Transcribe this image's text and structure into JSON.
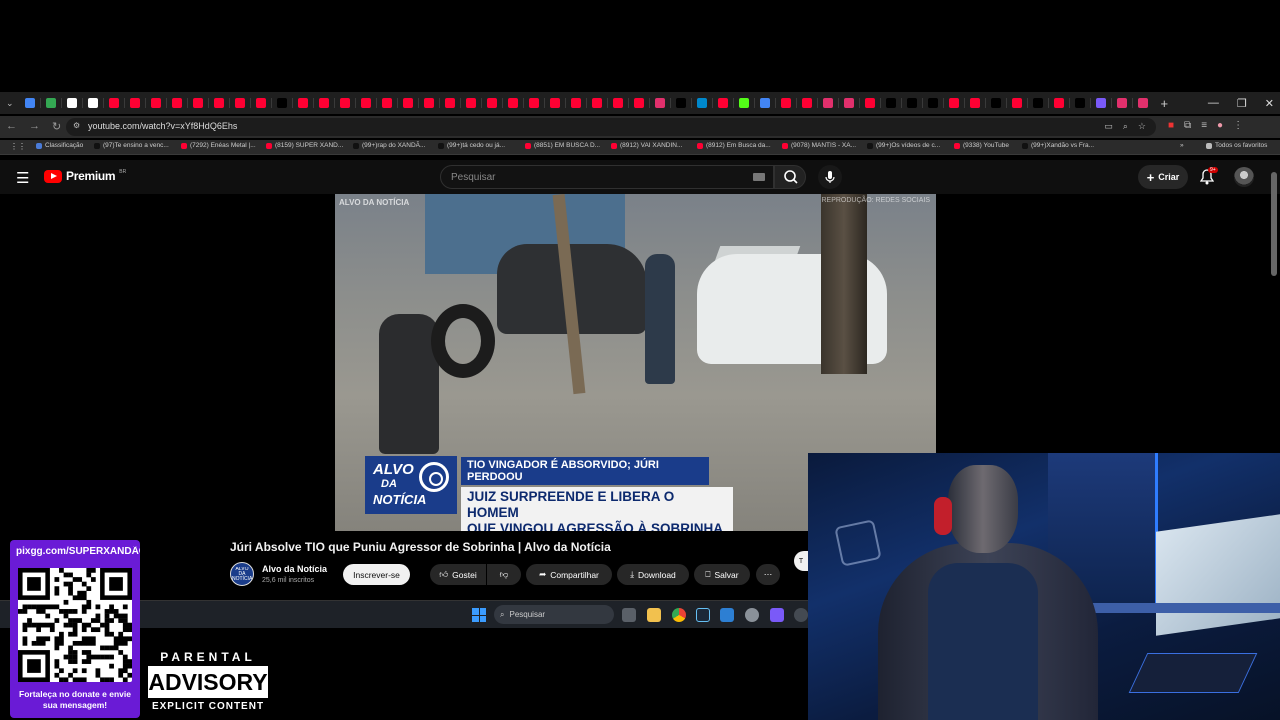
{
  "browser": {
    "tab_colors": [
      "#4285f4",
      "#34a853",
      "#fff",
      "#ffffff",
      "#ff0033",
      "#ff0033",
      "#ff0033",
      "#ff0033",
      "#ff0033",
      "#ff0033",
      "#ff0033",
      "#ff0033",
      "#000",
      "#ff0033",
      "#ff0033",
      "#ff0033",
      "#ff0033",
      "#ff0033",
      "#ff0033",
      "#ff0033",
      "#ff0033",
      "#ff0033",
      "#ff0033",
      "#ff0033",
      "#ff0033",
      "#ff0033",
      "#ff0033",
      "#ff0033",
      "#ff0033",
      "#ff0033",
      "#e1306c",
      "#000",
      "#0088cc",
      "#ff0033",
      "#53fc18",
      "#4285f4",
      "#ff0033",
      "#ff0033",
      "#e1306c",
      "#e1306c",
      "#ff0033",
      "#000",
      "#000",
      "#000",
      "#ff0033",
      "#ff0033",
      "#000",
      "#ff0033",
      "#000",
      "#ff0033",
      "#000",
      "#7a5af8",
      "#e1306c",
      "#e1306c"
    ],
    "url": "youtube.com/watch?v=xYf8HdQ6Ehs",
    "bookmarks": [
      {
        "label": "Classificação",
        "color": "#4a7bd8"
      },
      {
        "label": "(97)Te ensino a venc...",
        "color": "#111"
      },
      {
        "label": "(7292) Enéas Metal |...",
        "color": "#ff0033"
      },
      {
        "label": "(8159) SUPER XAND...",
        "color": "#ff0033"
      },
      {
        "label": "(99+)rap do XANDÃ...",
        "color": "#111"
      },
      {
        "label": "(99+)tá cedo ou já...",
        "color": "#111"
      },
      {
        "label": "(8851) EM BUSCA D...",
        "color": "#ff0033"
      },
      {
        "label": "(8912) VAI XANDIN...",
        "color": "#ff0033"
      },
      {
        "label": "(8912) Em Busca da...",
        "color": "#ff0033"
      },
      {
        "label": "(9078) MANTIS - XA...",
        "color": "#ff0033"
      },
      {
        "label": "(99+)Os vídeos de c...",
        "color": "#111"
      },
      {
        "label": "(9338) YouTube",
        "color": "#ff0033"
      },
      {
        "label": "(99+)Xandão vs Fra...",
        "color": "#111"
      }
    ],
    "all_favorites": "Todos os favoritos"
  },
  "youtube": {
    "brand": "Premium",
    "region": "BR",
    "search_placeholder": "Pesquisar",
    "create_label": "Criar",
    "notif_count": "9+",
    "video": {
      "watermark_left": "ALVO DA NOTÍCIA",
      "watermark_right": "REPRODUÇÃO: REDES SOCIAIS",
      "lt_logo_line1": "ALVO",
      "lt_logo_line2": "DA",
      "lt_logo_line3": "NOTÍCIA",
      "kicker": "TIO VINGADOR É ABSORVIDO; JÚRI PERDOOU",
      "headline_1": "JUIZ SURPREENDE E LIBERA O HOMEM",
      "headline_2": "QUE VINGOU AGRESSÃO À SOBRINHA"
    },
    "title": "Júri Absolve TIO que Puniu Agressor de Sobrinha | Alvo da Notícia",
    "channel": {
      "name": "Alvo da Notícia",
      "subscribers": "25,6 mil inscritos",
      "avatar_text": "ALVO DA NOTÍCIA"
    },
    "subscribe_label": "Inscrever-se",
    "actions": {
      "like": "Gostei",
      "share": "Compartilhar",
      "download": "Download",
      "save": "Salvar"
    },
    "peek_label": "T"
  },
  "taskbar": {
    "search_label": "Pesquisar"
  },
  "overlay": {
    "donate_url": "pixgg.com/SUPERXANDÃO",
    "donate_message": "Fortaleça no donate e envie sua mensagem!",
    "advisory_top": "PARENTAL",
    "advisory_mid": "ADVISORY",
    "advisory_bottom": "EXPLICIT CONTENT"
  }
}
